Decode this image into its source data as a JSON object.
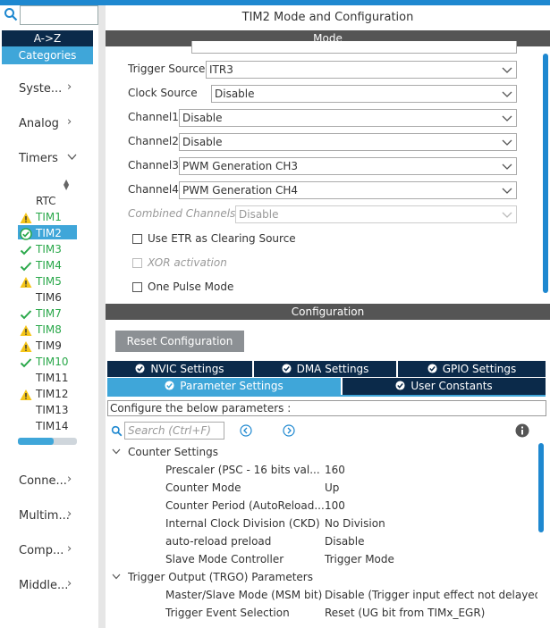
{
  "sidebar": {
    "sort_az": "A->Z",
    "categories": "Categories",
    "groups_top": [
      {
        "label": "Syste...",
        "state": "collapsed"
      },
      {
        "label": "Analog",
        "state": "collapsed"
      },
      {
        "label": "Timers",
        "state": "expanded"
      }
    ],
    "timers": [
      {
        "label": "RTC",
        "status": "none"
      },
      {
        "label": "TIM1",
        "status": "warning"
      },
      {
        "label": "TIM2",
        "status": "ok-selected"
      },
      {
        "label": "TIM3",
        "status": "ok"
      },
      {
        "label": "TIM4",
        "status": "ok"
      },
      {
        "label": "TIM5",
        "status": "warning"
      },
      {
        "label": "TIM6",
        "status": "none"
      },
      {
        "label": "TIM7",
        "status": "ok"
      },
      {
        "label": "TIM8",
        "status": "warning"
      },
      {
        "label": "TIM9",
        "status": "warning"
      },
      {
        "label": "TIM10",
        "status": "ok"
      },
      {
        "label": "TIM11",
        "status": "none"
      },
      {
        "label": "TIM12",
        "status": "warning"
      },
      {
        "label": "TIM13",
        "status": "none"
      },
      {
        "label": "TIM14",
        "status": "none"
      }
    ],
    "groups_bottom": [
      {
        "label": "Conne..."
      },
      {
        "label": "Multim..."
      },
      {
        "label": "Comp..."
      },
      {
        "label": "Middle..."
      }
    ]
  },
  "title": "TIM2 Mode and Configuration",
  "mode": {
    "header": "Mode",
    "fields": [
      {
        "label": "Trigger Source",
        "value": "ITR3",
        "disabled": false
      },
      {
        "label": "Clock Source",
        "value": "Disable",
        "disabled": false
      },
      {
        "label": "Channel1",
        "value": "Disable",
        "disabled": false
      },
      {
        "label": "Channel2",
        "value": "Disable",
        "disabled": false
      },
      {
        "label": "Channel3",
        "value": "PWM Generation CH3",
        "disabled": false
      },
      {
        "label": "Channel4",
        "value": "PWM Generation CH4",
        "disabled": false
      },
      {
        "label": "Combined Channels",
        "value": "Disable",
        "disabled": true
      }
    ],
    "checks": [
      {
        "label": "Use ETR as Clearing Source",
        "disabled": false,
        "checked": false
      },
      {
        "label": "XOR activation",
        "disabled": true,
        "checked": false
      },
      {
        "label": "One Pulse Mode",
        "disabled": false,
        "checked": false
      }
    ]
  },
  "config": {
    "header": "Configuration",
    "reset_button": "Reset Configuration",
    "tabs_row1": [
      "NVIC Settings",
      "DMA Settings",
      "GPIO Settings"
    ],
    "tabs_row2": [
      "Parameter Settings",
      "User Constants"
    ],
    "note": "Configure the below parameters :",
    "search_placeholder": "Search (Ctrl+F)",
    "sections": [
      {
        "title": "Counter Settings",
        "params": [
          {
            "name": "Prescaler (PSC - 16 bits val...",
            "value": "160"
          },
          {
            "name": "Counter Mode",
            "value": "Up"
          },
          {
            "name": "Counter Period (AutoReload...",
            "value": "100"
          },
          {
            "name": "Internal Clock Division (CKD)",
            "value": "No Division"
          },
          {
            "name": "auto-reload preload",
            "value": "Disable"
          },
          {
            "name": "Slave Mode Controller",
            "value": "Trigger Mode"
          }
        ]
      },
      {
        "title": "Trigger Output (TRGO) Parameters",
        "params": [
          {
            "name": "Master/Slave Mode (MSM bit)",
            "value": "Disable (Trigger input effect not delayed)"
          },
          {
            "name": "Trigger Event Selection",
            "value": "Reset (UG bit from TIMx_EGR)"
          }
        ]
      }
    ]
  },
  "colors": {
    "accent": "#3fa6d9",
    "navy": "#0b2a4a",
    "ok_green": "#2aa84a",
    "warn_yellow": "#f5c518",
    "header_gray": "#555555"
  }
}
